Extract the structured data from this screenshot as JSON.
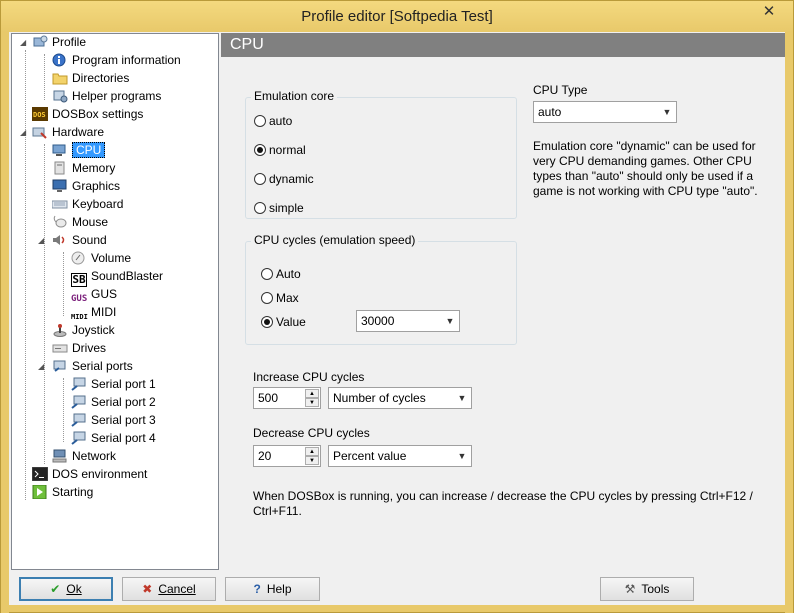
{
  "window": {
    "title": "Profile editor [Softpedia Test]",
    "close_glyph": "✕"
  },
  "tree": {
    "items": [
      {
        "label": "Profile",
        "icon": "profile-icon"
      },
      {
        "label": "Program information",
        "icon": "info-icon"
      },
      {
        "label": "Directories",
        "icon": "folder-icon"
      },
      {
        "label": "Helper programs",
        "icon": "helper-icon"
      },
      {
        "label": "DOSBox settings",
        "icon": "dosbox-icon"
      },
      {
        "label": "Hardware",
        "icon": "hardware-icon"
      },
      {
        "label": "CPU",
        "icon": "cpu-icon"
      },
      {
        "label": "Memory",
        "icon": "memory-icon"
      },
      {
        "label": "Graphics",
        "icon": "monitor-icon"
      },
      {
        "label": "Keyboard",
        "icon": "keyboard-icon"
      },
      {
        "label": "Mouse",
        "icon": "mouse-icon"
      },
      {
        "label": "Sound",
        "icon": "speaker-icon"
      },
      {
        "label": "Volume",
        "icon": "volume-icon"
      },
      {
        "label": "SoundBlaster",
        "icon": "soundblaster-icon"
      },
      {
        "label": "GUS",
        "icon": "gus-icon"
      },
      {
        "label": "MIDI",
        "icon": "midi-icon"
      },
      {
        "label": "Joystick",
        "icon": "joystick-icon"
      },
      {
        "label": "Drives",
        "icon": "drive-icon"
      },
      {
        "label": "Serial ports",
        "icon": "serial-ports-icon"
      },
      {
        "label": "Serial port 1",
        "icon": "serial-port-icon"
      },
      {
        "label": "Serial port 2",
        "icon": "serial-port-icon"
      },
      {
        "label": "Serial port 3",
        "icon": "serial-port-icon"
      },
      {
        "label": "Serial port 4",
        "icon": "serial-port-icon"
      },
      {
        "label": "Network",
        "icon": "network-icon"
      },
      {
        "label": "DOS environment",
        "icon": "dos-prompt-icon"
      },
      {
        "label": "Starting",
        "icon": "start-icon"
      }
    ],
    "selected": "CPU",
    "sb_badge": "SB",
    "gus_badge": "GUS",
    "midi_badge": "MIDI",
    "dos_badge": "DOS"
  },
  "panel": {
    "header": "CPU",
    "emulation_core": {
      "title": "Emulation core",
      "options": [
        "auto",
        "normal",
        "dynamic",
        "simple"
      ],
      "selected": "normal"
    },
    "cpu_type": {
      "label": "CPU Type",
      "value": "auto"
    },
    "description": "Emulation core \"dynamic\" can be used for very CPU demanding games. Other CPU types than \"auto\" should only be used if a game is not working with CPU type \"auto\".",
    "cpu_cycles": {
      "title": "CPU cycles (emulation speed)",
      "options": [
        "Auto",
        "Max",
        "Value"
      ],
      "selected": "Value",
      "value": "30000"
    },
    "increase": {
      "label": "Increase CPU cycles",
      "value": "500",
      "mode": "Number of cycles"
    },
    "decrease": {
      "label": "Decrease CPU cycles",
      "value": "20",
      "mode": "Percent value"
    },
    "footer_note": "When DOSBox is running, you can increase / decrease the CPU cycles by pressing Ctrl+F12 / Ctrl+F11."
  },
  "buttons": {
    "ok": "Ok",
    "cancel": "Cancel",
    "help": "Help",
    "tools": "Tools"
  },
  "colors": {
    "title_bar": "#e8c96a",
    "header": "#808080",
    "selection": "#3399ff"
  }
}
